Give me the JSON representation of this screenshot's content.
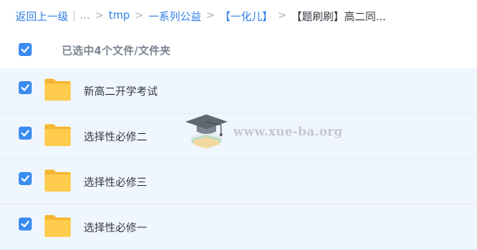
{
  "breadcrumb": {
    "back": "返回上一级",
    "ellipsis": "...",
    "items": [
      "tmp",
      "一系列公益",
      "【一化儿】"
    ],
    "current": "【题刷刷】高二同..."
  },
  "selection": {
    "summary": "已选中4个文件/文件夹"
  },
  "files": [
    {
      "name": "新高二开学考试",
      "icon": "folder-icon",
      "checked": true
    },
    {
      "name": "选择性必修二",
      "icon": "folder-icon",
      "checked": true
    },
    {
      "name": "选择性必修三",
      "icon": "folder-icon",
      "checked": true
    },
    {
      "name": "选择性必修一",
      "icon": "folder-icon",
      "checked": true
    }
  ],
  "watermark": {
    "text": "www.xue-ba.org",
    "icon": "graduation-cap-logo"
  },
  "colors": {
    "accent": "#3b8cf0",
    "link": "#2d7be5",
    "folder": "#ffcc4d",
    "row_bg": "#f0f6fd"
  }
}
